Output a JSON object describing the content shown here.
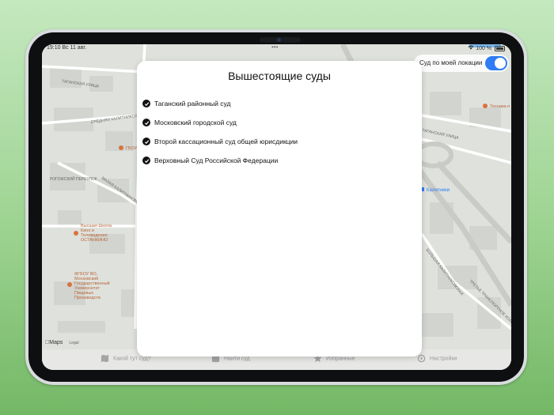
{
  "status_bar": {
    "time": "19:10",
    "date": "Вс 11 авг.",
    "battery": "100 %",
    "wifi_icon": "wifi-icon",
    "battery_icon": "battery-icon"
  },
  "location_toggle": {
    "label": "Суд по моей локации",
    "enabled": true
  },
  "map": {
    "attribution": "Maps",
    "legal": "Legal",
    "street_labels": [
      "Таганская улица",
      "Средняя Калитниковская улица",
      "Малая Калитниковская улица",
      "Большая Калитниковская улица",
      "Рогожский переулок",
      "Третье транспортное кольцо",
      "Калитники"
    ],
    "place_labels": [
      "ГБОУ",
      "Высшая Школа Кино и Телевидения ОСТАНКИНО",
      "ФГБОУ ВО, Московский Государственный Университет Пищевых Производств",
      "Техника-п"
    ]
  },
  "modal": {
    "title": "Вышестоящие суды",
    "items": [
      {
        "label": "Таганский районный суд"
      },
      {
        "label": "Московский городской суд"
      },
      {
        "label": "Второй кассационный суд общей юрисдикции"
      },
      {
        "label": "Верховный Суд Российской Федерации"
      }
    ]
  },
  "tabbar": {
    "items": [
      {
        "label": "Какой тут суд?",
        "icon": "map-icon"
      },
      {
        "label": "Найти суд",
        "icon": "search-icon"
      },
      {
        "label": "Избранные",
        "icon": "star-icon"
      },
      {
        "label": "Настройки",
        "icon": "gear-icon"
      }
    ]
  },
  "colors": {
    "accent": "#2f7cf6",
    "background_gradient_top": "#c4e8bf",
    "background_gradient_bottom": "#74b866"
  }
}
